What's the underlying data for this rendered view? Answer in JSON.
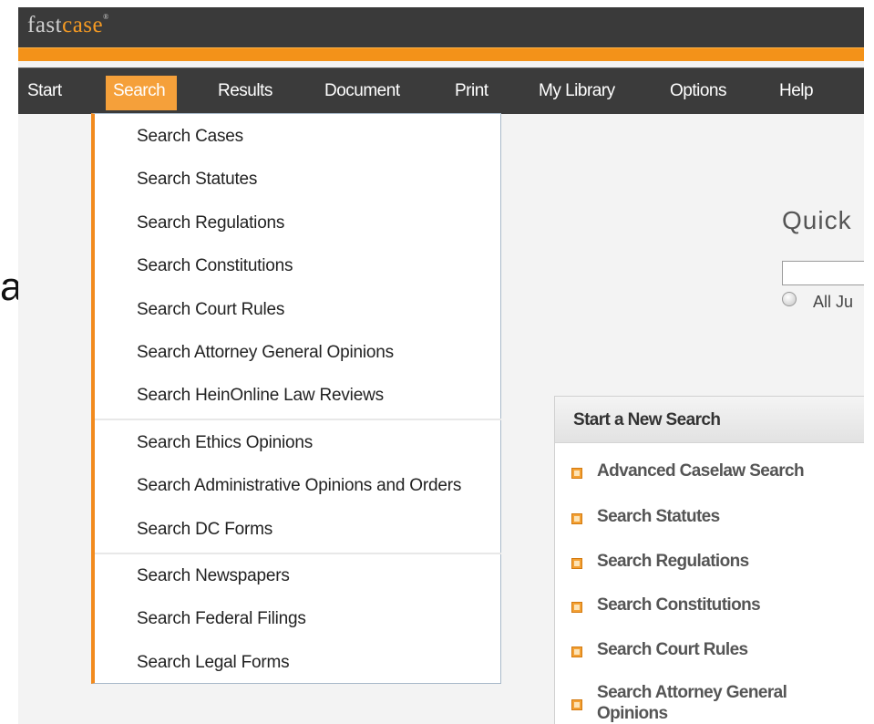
{
  "logo": {
    "part1": "fast",
    "part2": "case",
    "mark": "®"
  },
  "nav": {
    "items": [
      {
        "label": "Start"
      },
      {
        "label": "Search"
      },
      {
        "label": "Results"
      },
      {
        "label": "Document"
      },
      {
        "label": "Print"
      },
      {
        "label": "My Library"
      },
      {
        "label": "Options"
      },
      {
        "label": "Help"
      }
    ],
    "active": "Search"
  },
  "dropdown": {
    "items": [
      "Search Cases",
      "Search Statutes",
      "Search Regulations",
      "Search Constitutions",
      "Search Court Rules",
      "Search Attorney General Opinions",
      "Search HeinOnline Law Reviews",
      "Search Ethics Opinions",
      "Search Administrative Opinions and Orders",
      "Search DC Forms",
      "Search Newspapers",
      "Search Federal Filings",
      "Search Legal Forms"
    ]
  },
  "quick": {
    "title": "Quick",
    "radio_label": "All Ju"
  },
  "left_fragment": "at",
  "panel": {
    "title": "Start a New Search",
    "links": [
      [
        "Advanced Caselaw Search"
      ],
      [
        "Search Statutes"
      ],
      [
        "Search Regulations"
      ],
      [
        "Search Constitutions"
      ],
      [
        "Search Court Rules"
      ],
      [
        "Search Attorney General",
        "Opinions"
      ]
    ]
  },
  "colors": {
    "accent": "#f39219",
    "nav_bg": "#3b3b3b",
    "logo_bar": "#3a3a3a"
  }
}
